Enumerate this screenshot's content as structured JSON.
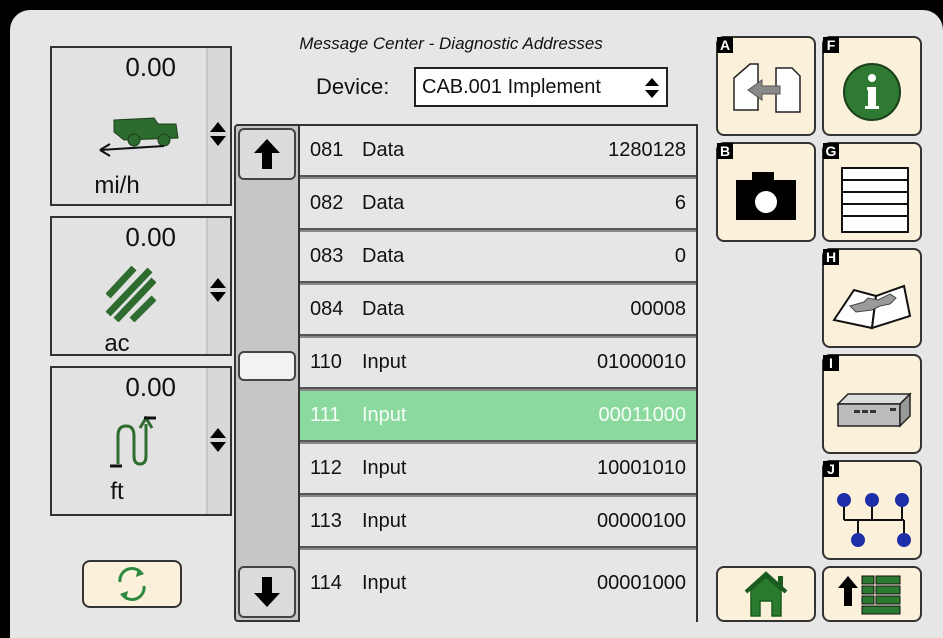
{
  "header": {
    "title": "Message Center - Diagnostic Addresses",
    "device_label": "Device:",
    "device_value": "CAB.001 Implement"
  },
  "gauges": [
    {
      "value": "0.00",
      "unit": "mi/h",
      "icon": "harvester-speed-icon"
    },
    {
      "value": "0.00",
      "unit": "ac",
      "icon": "area-hatch-icon"
    },
    {
      "value": "0.00",
      "unit": "ft",
      "icon": "implement-height-icon"
    }
  ],
  "rows": [
    {
      "code": "081",
      "type": "Data",
      "value": "1280128"
    },
    {
      "code": "082",
      "type": "Data",
      "value": "6"
    },
    {
      "code": "083",
      "type": "Data",
      "value": "0"
    },
    {
      "code": "084",
      "type": "Data",
      "value": "00008"
    },
    {
      "code": "110",
      "type": "Input",
      "value": "01000010"
    },
    {
      "code": "111",
      "type": "Input",
      "value": "00011000"
    },
    {
      "code": "112",
      "type": "Input",
      "value": "10001010"
    },
    {
      "code": "113",
      "type": "Input",
      "value": "00000100"
    },
    {
      "code": "114",
      "type": "Input",
      "value": "00001000"
    }
  ],
  "selected_row": 5,
  "side_buttons": [
    {
      "letter": "A",
      "icon": "document-transfer-icon"
    },
    {
      "letter": "F",
      "icon": "info-icon"
    },
    {
      "letter": "B",
      "icon": "camera-icon"
    },
    {
      "letter": "G",
      "icon": "list-table-icon"
    },
    {
      "letter": "H",
      "icon": "service-manual-icon"
    },
    {
      "letter": "I",
      "icon": "controller-module-icon"
    },
    {
      "letter": "J",
      "icon": "network-topology-icon"
    }
  ],
  "colors": {
    "button_bg": "#fbf0d9",
    "selected_row": "#8cd9a0",
    "icon_green": "#2e6b2e",
    "node_blue": "#1c2fa8"
  }
}
